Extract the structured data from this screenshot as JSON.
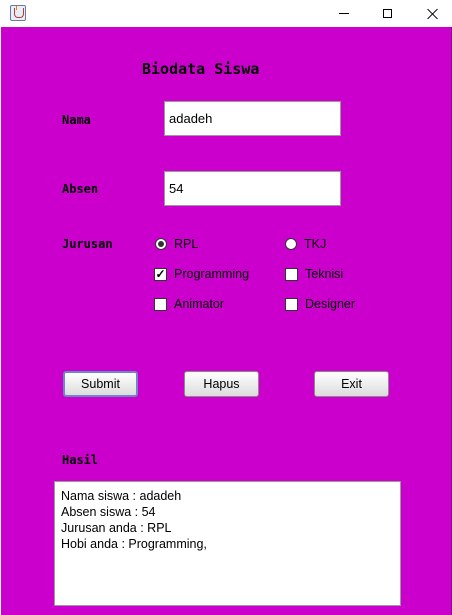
{
  "window": {
    "title": ""
  },
  "heading": "Biodata Siswa",
  "labels": {
    "nama": "Nama",
    "absen": "Absen",
    "jurusan": "Jurusan",
    "hasil": "Hasil"
  },
  "fields": {
    "nama_value": "adadeh",
    "absen_value": "54"
  },
  "jurusan": {
    "rpl": {
      "label": "RPL",
      "selected": true
    },
    "tkj": {
      "label": "TKJ",
      "selected": false
    }
  },
  "hobi": {
    "programming": {
      "label": "Programming",
      "checked": true
    },
    "teknisi": {
      "label": "Teknisi",
      "checked": false
    },
    "animator": {
      "label": "Animator",
      "checked": false
    },
    "designer": {
      "label": "Designer",
      "checked": false
    }
  },
  "buttons": {
    "submit": "Submit",
    "hapus": "Hapus",
    "exit": "Exit"
  },
  "result_lines": [
    "Nama siswa : adadeh",
    "Absen siswa : 54",
    "Jurusan anda : RPL",
    "Hobi anda : Programming,"
  ],
  "icons": {
    "check_mark": "✓"
  },
  "colors": {
    "background": "#cc00cc"
  }
}
